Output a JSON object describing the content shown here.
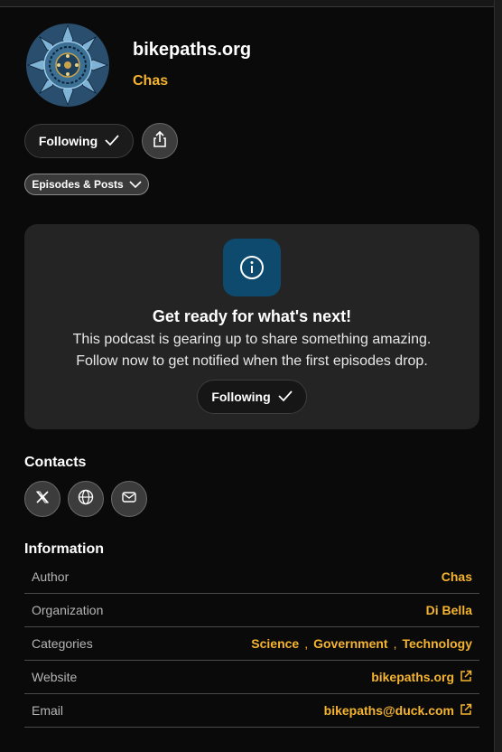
{
  "podcast": {
    "title": "bikepaths.org",
    "author": "Chas",
    "follow_label": "Following",
    "filter_label": "Episodes & Posts"
  },
  "card": {
    "icon": "info-icon",
    "title": "Get ready for what's next!",
    "line1": "This podcast is gearing up to share something amazing.",
    "line2": "Follow now to get notified when the first episodes drop.",
    "follow_label": "Following"
  },
  "contacts": {
    "heading": "Contacts",
    "icons": [
      "x-icon",
      "globe-icon",
      "mail-icon"
    ]
  },
  "information": {
    "heading": "Information",
    "author_label": "Author",
    "author_value": "Chas",
    "organization_label": "Organization",
    "organization_value": "Di Bella",
    "categories_label": "Categories",
    "categories": [
      "Science",
      "Government",
      "Technology"
    ],
    "category_separator": ",",
    "website_label": "Website",
    "website_value": "bikepaths.org",
    "email_label": "Email",
    "email_value": "bikepaths@duck.com"
  },
  "colors": {
    "accent": "#f5b430",
    "background": "#0a0a0a",
    "card": "#242424",
    "info_badge": "#0d4a6e"
  }
}
